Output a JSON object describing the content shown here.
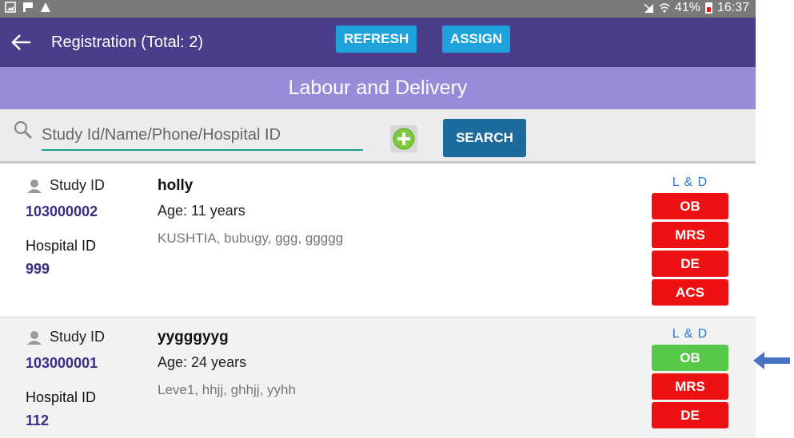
{
  "status_bar": {
    "battery": "41%",
    "time": "16:37",
    "icons": [
      "gallery-icon",
      "flag-icon",
      "warning-icon",
      "signal-icon",
      "wifi-icon",
      "battery-icon"
    ]
  },
  "app_bar": {
    "title": "Registration  (Total: 2)",
    "refresh_label": "REFRESH",
    "assign_label": "ASSIGN",
    "background": "#4a3e8c",
    "button_color": "#1ea2dc"
  },
  "section": {
    "title": "Labour and Delivery",
    "background": "#978bda"
  },
  "search": {
    "placeholder": "Study Id/Name/Phone/Hospital ID",
    "value": "",
    "button_label": "SEARCH",
    "button_color": "#1c6b9e"
  },
  "labels": {
    "study_id": "Study ID",
    "hospital_id": "Hospital ID",
    "ld": "L & D"
  },
  "records": [
    {
      "study_id": "103000002",
      "hospital_id": "999",
      "name": "holly",
      "age": "Age: 11 years",
      "address": "KUSHTIA, bubugy, ggg, ggggg",
      "tags": [
        {
          "label": "OB",
          "color": "#ee1111"
        },
        {
          "label": "MRS",
          "color": "#ee1111"
        },
        {
          "label": "DE",
          "color": "#ee1111"
        },
        {
          "label": "ACS",
          "color": "#ee1111"
        }
      ]
    },
    {
      "study_id": "103000001",
      "hospital_id": "112",
      "name": "yygggyyg",
      "age": "Age: 24 years",
      "address": "Leve1, hhjj, ghhjj, yyhh",
      "tags": [
        {
          "label": "OB",
          "color": "#58c84a"
        },
        {
          "label": "MRS",
          "color": "#ee1111"
        },
        {
          "label": "DE",
          "color": "#ee1111"
        }
      ]
    }
  ],
  "annotation": {
    "arrow_color": "#4a74c4"
  }
}
